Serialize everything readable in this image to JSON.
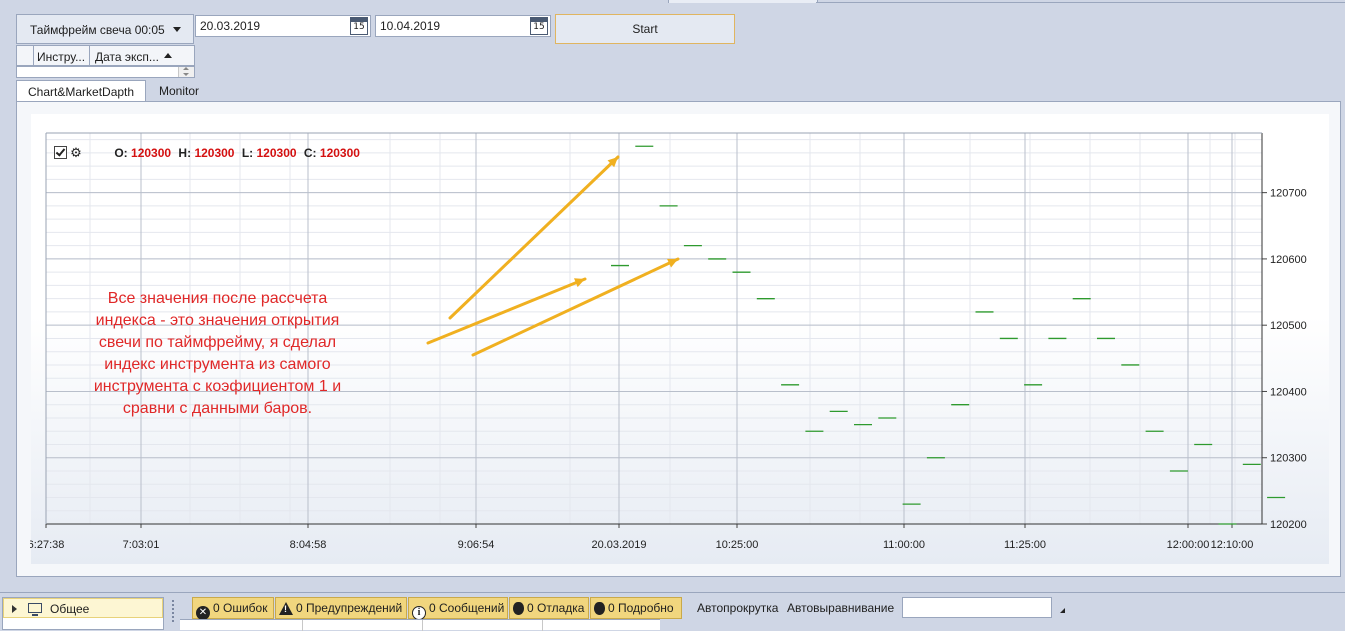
{
  "toolbar": {
    "timeframe_value": "Таймфрейм свеча 00:05",
    "date_from": "20.03.2019",
    "date_to": "10.04.2019",
    "calendar_day": "15",
    "start_label": "Start"
  },
  "grid": {
    "columns": [
      "Инстру...",
      "Дата эксп..."
    ]
  },
  "tabs": [
    {
      "label": "Chart&MarketDapth",
      "active": true
    },
    {
      "label": "Monitor",
      "active": false
    }
  ],
  "ohlc": {
    "o_label": "O:",
    "o_value": "120300",
    "h_label": "H:",
    "h_value": "120300",
    "l_label": "L:",
    "l_value": "120300",
    "c_label": "C:",
    "c_value": "120300"
  },
  "annotation": {
    "lines": [
      "Все значения после рассчета",
      "индекса - это значения открытия",
      "свечи по таймфрейму, я сделал",
      "индекс инструмента из самого",
      "инструмента с коэфициентом 1 и",
      "сравни с данными баров."
    ],
    "color": "#e02828",
    "arrow_color": "#f0b020"
  },
  "chart_data": {
    "type": "scatter",
    "series_color": "#2e9a2e",
    "x_tick_labels": [
      "6:27:38",
      "7:03:01",
      "8:04:58",
      "9:06:54",
      "20.03.2019",
      "10:25:00",
      "11:00:00",
      "11:25:00",
      "12:00:00",
      "12:10:00"
    ],
    "y_ticks": [
      120200,
      120300,
      120400,
      120500,
      120600,
      120700
    ],
    "ylim": [
      120200,
      120790
    ],
    "bars": [
      {
        "x": 1,
        "y": 120590
      },
      {
        "x": 2,
        "y": 120770
      },
      {
        "x": 3,
        "y": 120680
      },
      {
        "x": 4,
        "y": 120620
      },
      {
        "x": 5,
        "y": 120600
      },
      {
        "x": 6,
        "y": 120580
      },
      {
        "x": 7,
        "y": 120540
      },
      {
        "x": 8,
        "y": 120410
      },
      {
        "x": 9,
        "y": 120340
      },
      {
        "x": 10,
        "y": 120370
      },
      {
        "x": 11,
        "y": 120350
      },
      {
        "x": 12,
        "y": 120360
      },
      {
        "x": 13,
        "y": 120230
      },
      {
        "x": 14,
        "y": 120300
      },
      {
        "x": 15,
        "y": 120380
      },
      {
        "x": 16,
        "y": 120520
      },
      {
        "x": 17,
        "y": 120480
      },
      {
        "x": 18,
        "y": 120410
      },
      {
        "x": 19,
        "y": 120480
      },
      {
        "x": 20,
        "y": 120540
      },
      {
        "x": 21,
        "y": 120480
      },
      {
        "x": 22,
        "y": 120440
      },
      {
        "x": 23,
        "y": 120340
      },
      {
        "x": 24,
        "y": 120280
      },
      {
        "x": 25,
        "y": 120320
      },
      {
        "x": 26,
        "y": 120200
      },
      {
        "x": 27,
        "y": 120290
      },
      {
        "x": 28,
        "y": 120240
      }
    ]
  },
  "bottom": {
    "tree_item": "Общее",
    "log_buttons": [
      "0 Ошибок",
      "0 Предупреждений",
      "0 Сообщений",
      "0 Отладка",
      "0 Подробно"
    ],
    "autoscroll": "Автопрокрутка",
    "autoalign": "Автовыравнивание"
  }
}
